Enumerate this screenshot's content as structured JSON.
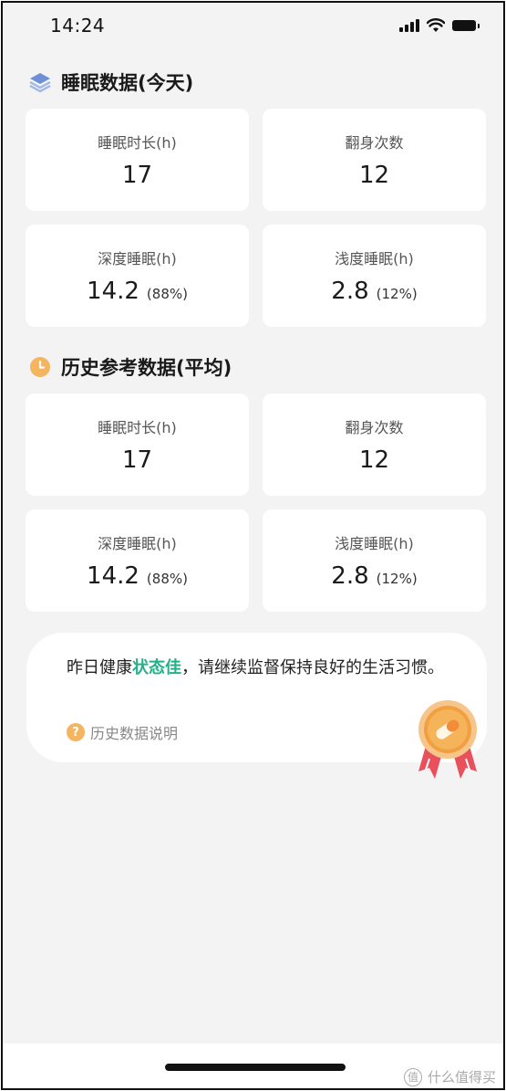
{
  "status_bar": {
    "time": "14:24"
  },
  "today": {
    "title": "睡眠数据(今天)",
    "cards": [
      {
        "label": "睡眠时长(h)",
        "value": "17",
        "percent": ""
      },
      {
        "label": "翻身次数",
        "value": "12",
        "percent": ""
      },
      {
        "label": "深度睡眠(h)",
        "value": "14.2",
        "percent": "(88%)"
      },
      {
        "label": "浅度睡眠(h)",
        "value": "2.8",
        "percent": "(12%)"
      }
    ]
  },
  "history": {
    "title": "历史参考数据(平均)",
    "cards": [
      {
        "label": "睡眠时长(h)",
        "value": "17",
        "percent": ""
      },
      {
        "label": "翻身次数",
        "value": "12",
        "percent": ""
      },
      {
        "label": "深度睡眠(h)",
        "value": "14.2",
        "percent": "(88%)"
      },
      {
        "label": "浅度睡眠(h)",
        "value": "2.8",
        "percent": "(12%)"
      }
    ]
  },
  "summary": {
    "text_before": "昨日健康",
    "highlight": "状态佳",
    "text_after": "，请继续监督保持良好的生活习惯。",
    "help_label": "历史数据说明",
    "help_icon_glyph": "?"
  },
  "watermark": {
    "badge": "值",
    "text": "什么值得买"
  },
  "colors": {
    "highlight": "#26b08a",
    "medal": "#f0a040",
    "help": "#f4b460",
    "layers": "#6f8fd6"
  }
}
